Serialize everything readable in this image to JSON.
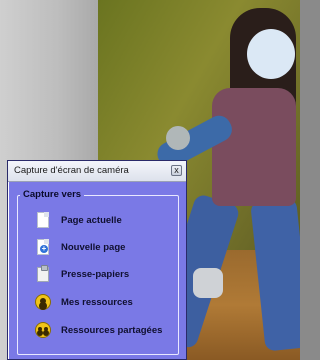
{
  "window": {
    "title": "Capture d'écran de caméra",
    "close_symbol": "x"
  },
  "capture_group": {
    "legend": "Capture vers",
    "items": [
      {
        "label": "Page actuelle",
        "icon": "page-icon"
      },
      {
        "label": "Nouvelle page",
        "icon": "new-page-icon"
      },
      {
        "label": "Presse-papiers",
        "icon": "clipboard-icon"
      },
      {
        "label": "Mes ressources",
        "icon": "my-resources-icon"
      },
      {
        "label": "Ressources partagées",
        "icon": "shared-resources-icon"
      }
    ]
  },
  "colors": {
    "window_bg": "#7a79e6",
    "face_blur": "#dbe8f5"
  }
}
